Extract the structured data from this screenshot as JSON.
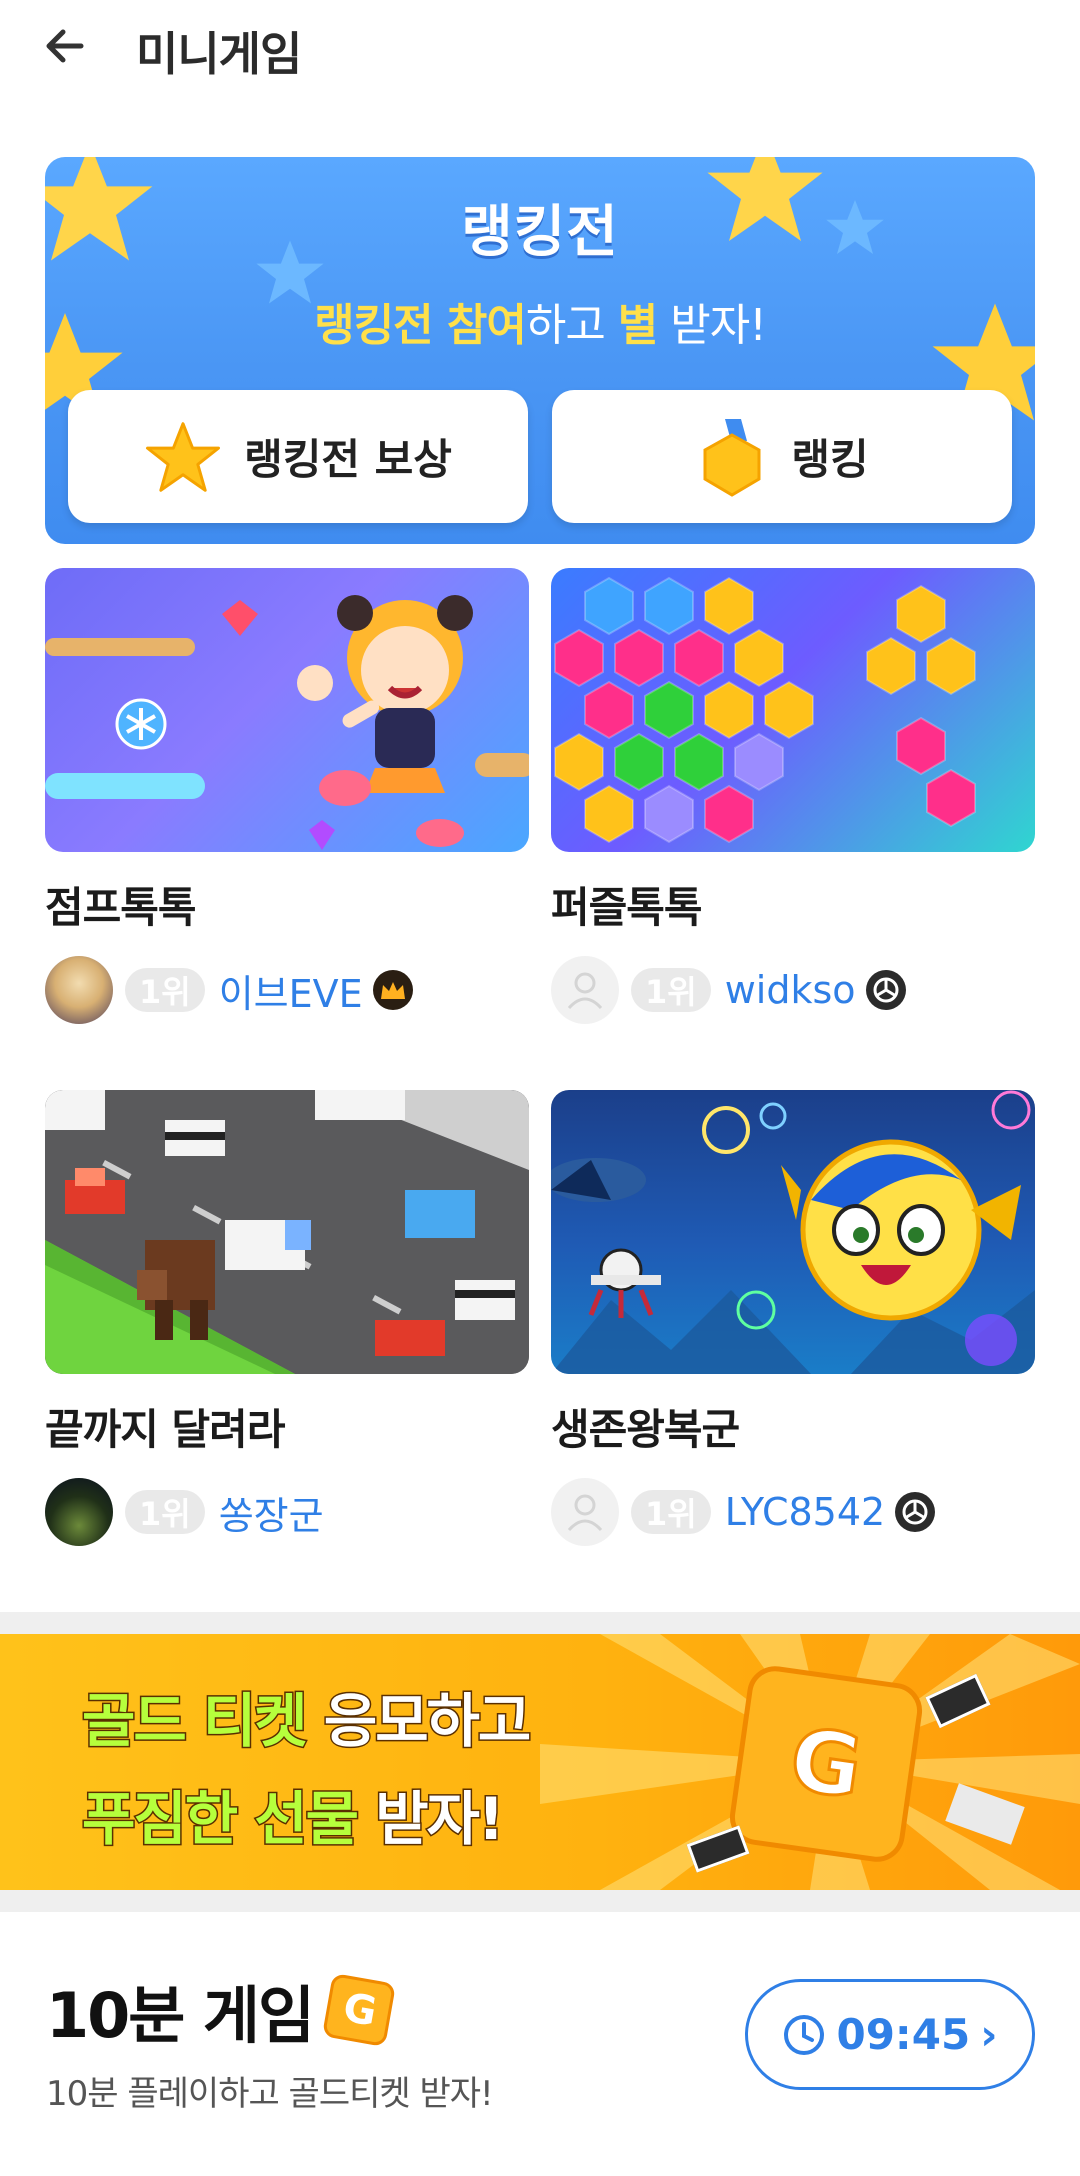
{
  "header": {
    "title": "미니게임",
    "back_icon": "arrow-left-icon"
  },
  "ranking_banner": {
    "title": "랭킹전",
    "subtitle_parts": [
      "랭킹전 참여",
      "하고 ",
      "별",
      " 받자!"
    ],
    "reward_button": "랭킹전 보상",
    "ranking_button": "랭킹",
    "colors": {
      "background": "#4a96f4",
      "highlight": "#ffe04a"
    }
  },
  "games": [
    {
      "name": "점프톡톡",
      "rank_label": "1위",
      "ranker": "이브EVE",
      "badge": "crown-badge-icon"
    },
    {
      "name": "퍼즐톡톡",
      "rank_label": "1위",
      "ranker": "widkso",
      "badge": "shield-badge-icon"
    },
    {
      "name": "끝까지 달려라",
      "rank_label": "1위",
      "ranker": "쏭장군",
      "badge": ""
    },
    {
      "name": "생존왕복군",
      "rank_label": "1위",
      "ranker": "LYC8542",
      "badge": "shield-badge-icon"
    }
  ],
  "gold_banner": {
    "line1_highlight": "골드 티켓",
    "line1_rest": " 응모하고",
    "line2_highlight": "푸짐한 선물",
    "line2_rest": " 받자!",
    "ticket_letter": "G"
  },
  "ten_minute_game": {
    "title": "10분 게임",
    "subtitle": "10분 플레이하고 골드티켓 받자!",
    "timer": "09:45",
    "chevron": "›"
  }
}
